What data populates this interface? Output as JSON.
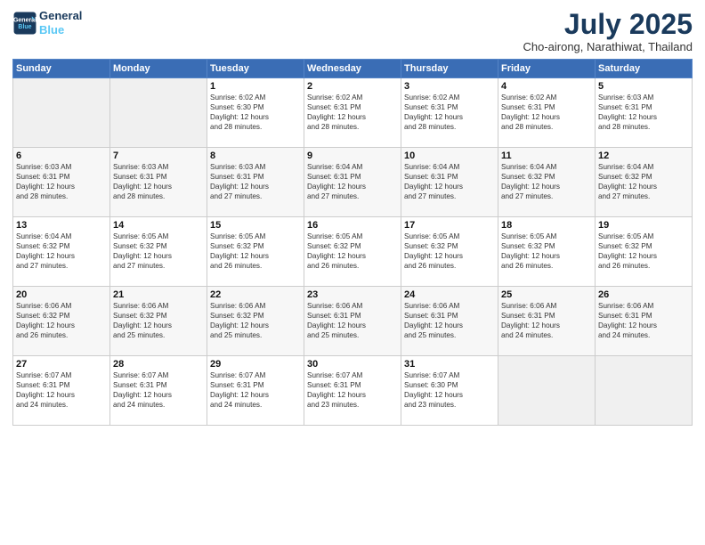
{
  "logo": {
    "line1": "General",
    "line2": "Blue"
  },
  "title": "July 2025",
  "subtitle": "Cho-airong, Narathiwat, Thailand",
  "days_header": [
    "Sunday",
    "Monday",
    "Tuesday",
    "Wednesday",
    "Thursday",
    "Friday",
    "Saturday"
  ],
  "weeks": [
    [
      {
        "num": "",
        "info": "",
        "empty": true
      },
      {
        "num": "",
        "info": "",
        "empty": true
      },
      {
        "num": "1",
        "info": "Sunrise: 6:02 AM\nSunset: 6:30 PM\nDaylight: 12 hours\nand 28 minutes."
      },
      {
        "num": "2",
        "info": "Sunrise: 6:02 AM\nSunset: 6:31 PM\nDaylight: 12 hours\nand 28 minutes."
      },
      {
        "num": "3",
        "info": "Sunrise: 6:02 AM\nSunset: 6:31 PM\nDaylight: 12 hours\nand 28 minutes."
      },
      {
        "num": "4",
        "info": "Sunrise: 6:02 AM\nSunset: 6:31 PM\nDaylight: 12 hours\nand 28 minutes."
      },
      {
        "num": "5",
        "info": "Sunrise: 6:03 AM\nSunset: 6:31 PM\nDaylight: 12 hours\nand 28 minutes."
      }
    ],
    [
      {
        "num": "6",
        "info": "Sunrise: 6:03 AM\nSunset: 6:31 PM\nDaylight: 12 hours\nand 28 minutes."
      },
      {
        "num": "7",
        "info": "Sunrise: 6:03 AM\nSunset: 6:31 PM\nDaylight: 12 hours\nand 28 minutes."
      },
      {
        "num": "8",
        "info": "Sunrise: 6:03 AM\nSunset: 6:31 PM\nDaylight: 12 hours\nand 27 minutes."
      },
      {
        "num": "9",
        "info": "Sunrise: 6:04 AM\nSunset: 6:31 PM\nDaylight: 12 hours\nand 27 minutes."
      },
      {
        "num": "10",
        "info": "Sunrise: 6:04 AM\nSunset: 6:31 PM\nDaylight: 12 hours\nand 27 minutes."
      },
      {
        "num": "11",
        "info": "Sunrise: 6:04 AM\nSunset: 6:32 PM\nDaylight: 12 hours\nand 27 minutes."
      },
      {
        "num": "12",
        "info": "Sunrise: 6:04 AM\nSunset: 6:32 PM\nDaylight: 12 hours\nand 27 minutes."
      }
    ],
    [
      {
        "num": "13",
        "info": "Sunrise: 6:04 AM\nSunset: 6:32 PM\nDaylight: 12 hours\nand 27 minutes."
      },
      {
        "num": "14",
        "info": "Sunrise: 6:05 AM\nSunset: 6:32 PM\nDaylight: 12 hours\nand 27 minutes."
      },
      {
        "num": "15",
        "info": "Sunrise: 6:05 AM\nSunset: 6:32 PM\nDaylight: 12 hours\nand 26 minutes."
      },
      {
        "num": "16",
        "info": "Sunrise: 6:05 AM\nSunset: 6:32 PM\nDaylight: 12 hours\nand 26 minutes."
      },
      {
        "num": "17",
        "info": "Sunrise: 6:05 AM\nSunset: 6:32 PM\nDaylight: 12 hours\nand 26 minutes."
      },
      {
        "num": "18",
        "info": "Sunrise: 6:05 AM\nSunset: 6:32 PM\nDaylight: 12 hours\nand 26 minutes."
      },
      {
        "num": "19",
        "info": "Sunrise: 6:05 AM\nSunset: 6:32 PM\nDaylight: 12 hours\nand 26 minutes."
      }
    ],
    [
      {
        "num": "20",
        "info": "Sunrise: 6:06 AM\nSunset: 6:32 PM\nDaylight: 12 hours\nand 26 minutes."
      },
      {
        "num": "21",
        "info": "Sunrise: 6:06 AM\nSunset: 6:32 PM\nDaylight: 12 hours\nand 25 minutes."
      },
      {
        "num": "22",
        "info": "Sunrise: 6:06 AM\nSunset: 6:32 PM\nDaylight: 12 hours\nand 25 minutes."
      },
      {
        "num": "23",
        "info": "Sunrise: 6:06 AM\nSunset: 6:31 PM\nDaylight: 12 hours\nand 25 minutes."
      },
      {
        "num": "24",
        "info": "Sunrise: 6:06 AM\nSunset: 6:31 PM\nDaylight: 12 hours\nand 25 minutes."
      },
      {
        "num": "25",
        "info": "Sunrise: 6:06 AM\nSunset: 6:31 PM\nDaylight: 12 hours\nand 24 minutes."
      },
      {
        "num": "26",
        "info": "Sunrise: 6:06 AM\nSunset: 6:31 PM\nDaylight: 12 hours\nand 24 minutes."
      }
    ],
    [
      {
        "num": "27",
        "info": "Sunrise: 6:07 AM\nSunset: 6:31 PM\nDaylight: 12 hours\nand 24 minutes."
      },
      {
        "num": "28",
        "info": "Sunrise: 6:07 AM\nSunset: 6:31 PM\nDaylight: 12 hours\nand 24 minutes."
      },
      {
        "num": "29",
        "info": "Sunrise: 6:07 AM\nSunset: 6:31 PM\nDaylight: 12 hours\nand 24 minutes."
      },
      {
        "num": "30",
        "info": "Sunrise: 6:07 AM\nSunset: 6:31 PM\nDaylight: 12 hours\nand 23 minutes."
      },
      {
        "num": "31",
        "info": "Sunrise: 6:07 AM\nSunset: 6:30 PM\nDaylight: 12 hours\nand 23 minutes."
      },
      {
        "num": "",
        "info": "",
        "empty": true
      },
      {
        "num": "",
        "info": "",
        "empty": true
      }
    ]
  ]
}
